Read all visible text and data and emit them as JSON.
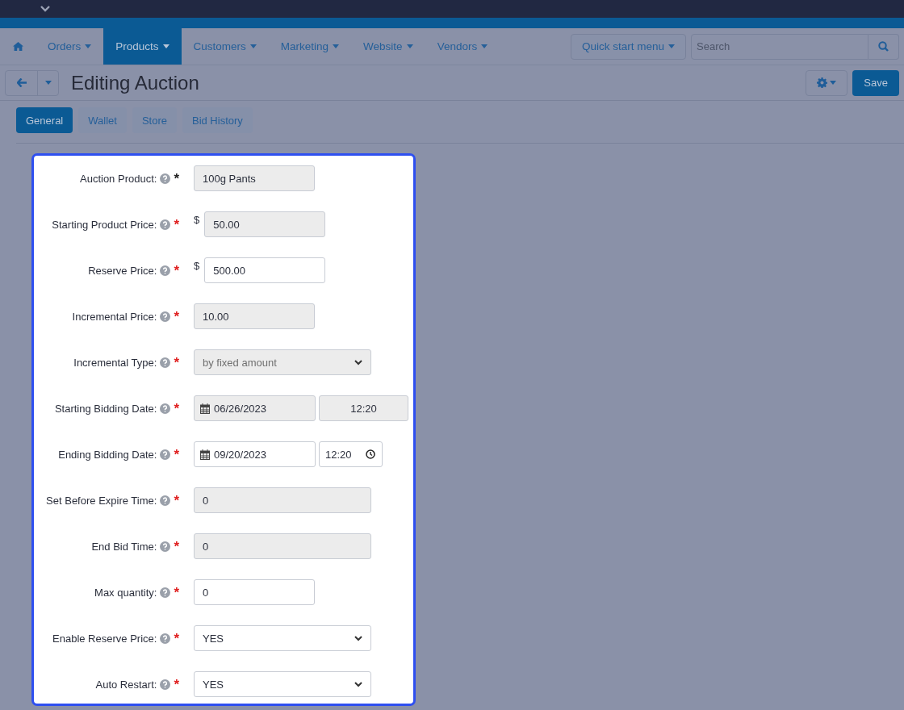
{
  "nav": {
    "items": [
      {
        "label": "Orders",
        "selected": false
      },
      {
        "label": "Products",
        "selected": true
      },
      {
        "label": "Customers",
        "selected": false
      },
      {
        "label": "Marketing",
        "selected": false
      },
      {
        "label": "Website",
        "selected": false
      },
      {
        "label": "Vendors",
        "selected": false
      }
    ],
    "quick_start": "Quick start menu",
    "search": {
      "placeholder": "Search"
    }
  },
  "toolbar": {
    "title": "Editing Auction",
    "save": "Save"
  },
  "tabs": [
    {
      "label": "General",
      "selected": true
    },
    {
      "label": "Wallet",
      "selected": false
    },
    {
      "label": "Store",
      "selected": false
    },
    {
      "label": "Bid History",
      "selected": false
    }
  ],
  "fields": [
    {
      "kind": "input",
      "label": "Auction Product:",
      "required_mark": "*",
      "color": "#222222",
      "value": "100g Pants",
      "disabled": true
    },
    {
      "kind": "currency",
      "label": "Starting Product Price:",
      "required_mark": "*",
      "color": "#e02020",
      "currency": "$",
      "value": "50.00",
      "disabled": true
    },
    {
      "kind": "currency",
      "label": "Reserve Price:",
      "required_mark": "*",
      "color": "#e02020",
      "currency": "$",
      "value": "500.00",
      "disabled": false
    },
    {
      "kind": "input",
      "label": "Incremental Price:",
      "required_mark": "*",
      "color": "#e02020",
      "value": "10.00",
      "disabled": true
    },
    {
      "kind": "select",
      "label": "Incremental Type:",
      "required_mark": "*",
      "color": "#e02020",
      "value": "by fixed amount",
      "disabled": true
    },
    {
      "kind": "datetime",
      "label": "Starting Bidding Date:",
      "required_mark": "*",
      "color": "#e02020",
      "date": "06/26/2023",
      "time": "12:20",
      "disabled": true
    },
    {
      "kind": "datetime",
      "label": "Ending Bidding Date:",
      "required_mark": "*",
      "color": "#e02020",
      "date": "09/20/2023",
      "time": "12:20",
      "disabled": false
    },
    {
      "kind": "long-input",
      "label": "Set Before Expire Time:",
      "required_mark": "*",
      "color": "#e02020",
      "value": "0",
      "disabled": true
    },
    {
      "kind": "long-input",
      "label": "End Bid Time:",
      "required_mark": "*",
      "color": "#e02020",
      "value": "0",
      "disabled": true
    },
    {
      "kind": "input",
      "label": "Max quantity:",
      "required_mark": "*",
      "color": "#e02020",
      "value": "0",
      "disabled": false
    },
    {
      "kind": "select",
      "label": "Enable Reserve Price:",
      "required_mark": "*",
      "color": "#e02020",
      "value": "YES",
      "disabled": false
    },
    {
      "kind": "select",
      "label": "Auto Restart:",
      "required_mark": "*",
      "color": "#e02020",
      "value": "YES",
      "disabled": false
    }
  ]
}
